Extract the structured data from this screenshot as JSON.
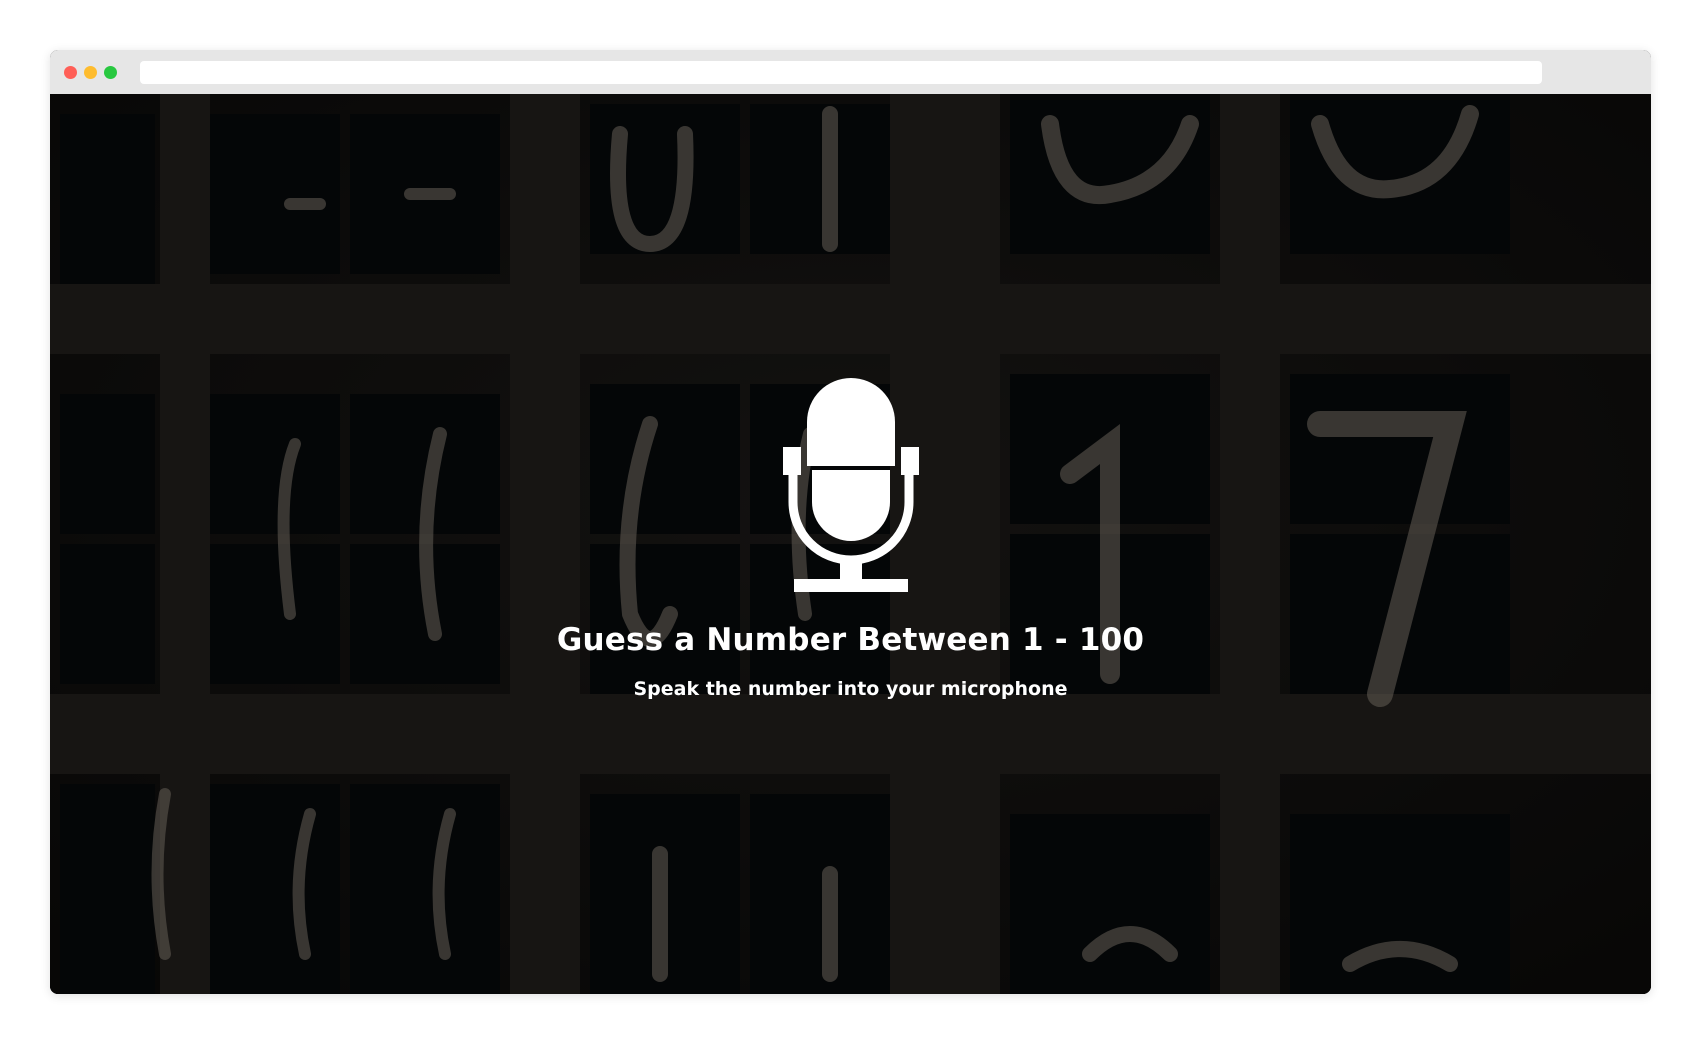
{
  "browser": {
    "window_controls": [
      "close",
      "minimize",
      "maximize"
    ],
    "address_bar_value": ""
  },
  "hero": {
    "icon": "microphone-icon",
    "title": "Guess a Number Between 1 - 100",
    "subtitle": "Speak the number into your microphone"
  },
  "colors": {
    "text": "#ffffff",
    "close": "#ff5f57",
    "minimize": "#febc2e",
    "maximize": "#28c840"
  }
}
